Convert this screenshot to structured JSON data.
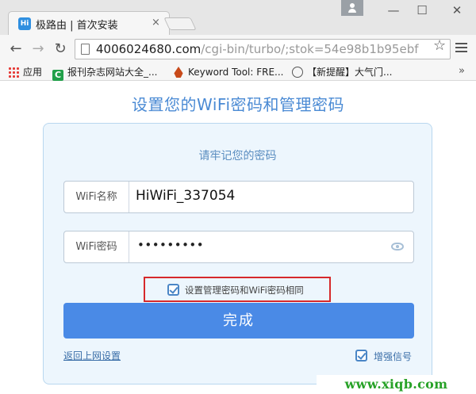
{
  "browser": {
    "tab": {
      "favicon_text": "Hi",
      "title": "极路由 | 首次安装",
      "close": "×"
    },
    "window_controls": {
      "minimize": "—",
      "maximize": "☐",
      "close": "✕"
    },
    "nav": {
      "back": "←",
      "forward": "→",
      "reload": "↻"
    },
    "url": {
      "host": "4006024680.com",
      "path": "/cgi-bin/turbo/;stok=54e98b1b95ebf"
    },
    "star": "☆",
    "bookmarks": [
      {
        "label": "应用",
        "icon": "apps-icon"
      },
      {
        "label": "报刊杂志网站大全_...",
        "icon": "c-icon",
        "icon_text": "C"
      },
      {
        "label": "Keyword Tool: FRE...",
        "icon": "flame-icon"
      },
      {
        "label": "【新提醒】大气门...",
        "icon": "wordpress-icon"
      }
    ],
    "more": "»"
  },
  "page": {
    "title": "设置您的WiFi密码和管理密码",
    "subtitle": "请牢记您的密码",
    "wifi_name": {
      "label": "WiFi名称",
      "value": "HiWiFi_337054"
    },
    "wifi_password": {
      "label": "WiFi密码",
      "value": "•••••••••"
    },
    "same_password": {
      "label": "设置管理密码和WiFi密码相同",
      "checked": true,
      "highlight_color": "#d6292b"
    },
    "done_button": "完成",
    "back_link": "返回上网设置",
    "boost_signal": {
      "label": "增强信号",
      "checked": true
    },
    "accent_color": "#4a8ae6"
  },
  "watermark": "www.xiqb.com"
}
